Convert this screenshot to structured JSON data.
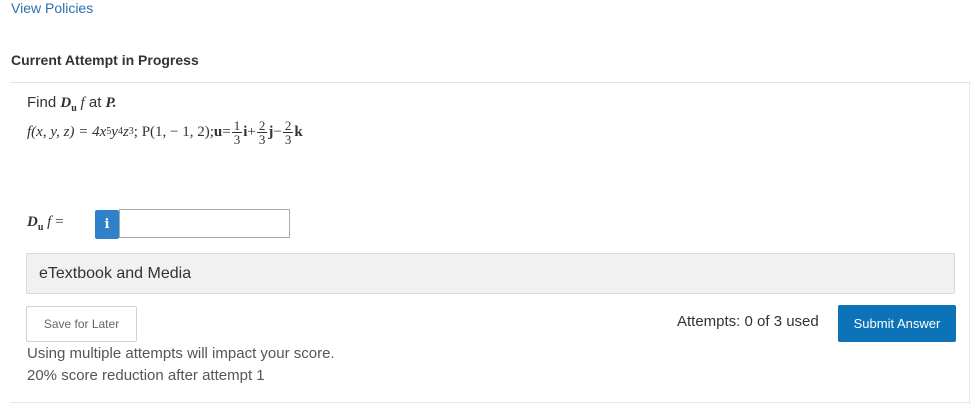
{
  "header": {
    "view_policies": "View Policies",
    "attempt_status": "Current Attempt in Progress"
  },
  "question": {
    "prompt_find": "Find",
    "prompt_D": "D",
    "prompt_u": "u",
    "prompt_f": "f",
    "prompt_at": "at",
    "prompt_P": "P.",
    "math": {
      "f_lhs": "f(x, y, z) = 4x",
      "exp_x": "5",
      "y": "y",
      "exp_y": "4",
      "z": "z",
      "exp_z": "3",
      "point": "; P(1, − 1, 2); ",
      "u_label": "u",
      "equals": " = ",
      "c1_num": "1",
      "c1_den": "3",
      "i": "i",
      "plus": " + ",
      "c2_num": "2",
      "c2_den": "3",
      "j": "j",
      "minus": " − ",
      "c3_num": "2",
      "c3_den": "3",
      "k": "k"
    },
    "answer_label_D": "D",
    "answer_label_u": "u",
    "answer_label_f": "f",
    "answer_label_eq": " =",
    "info_icon_glyph": "i",
    "answer_value": ""
  },
  "resources": {
    "etextbook_label": "eTextbook and Media"
  },
  "actions": {
    "save_label": "Save for Later",
    "attempts_text": "Attempts: 0 of 3 used",
    "submit_label": "Submit Answer"
  },
  "notes": {
    "line1": "Using multiple attempts will impact your score.",
    "line2": "20% score reduction after attempt 1"
  },
  "colors": {
    "link": "#2f6fb0",
    "primary_button": "#0c73b8",
    "info_button": "#2f82c9"
  }
}
